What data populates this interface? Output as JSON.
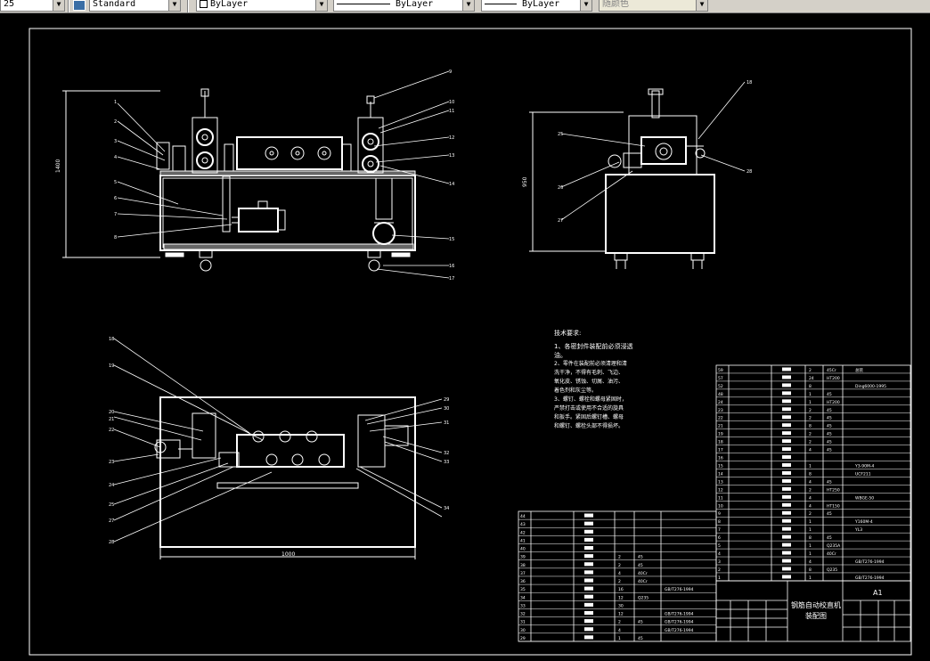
{
  "toolbar": {
    "text_height": "25",
    "dim_style": "Standard",
    "layer": "ByLayer",
    "linetype": "ByLayer",
    "lineweight": "ByLayer",
    "color": "随颜色"
  },
  "drawing": {
    "front_callouts": [
      "1",
      "2",
      "3",
      "4",
      "5",
      "6",
      "7",
      "8",
      "9",
      "10",
      "11",
      "12",
      "13",
      "14",
      "15",
      "16",
      "17"
    ],
    "side_callouts": [
      "18",
      "25",
      "26",
      "27",
      "28"
    ],
    "plan_callouts": [
      "18",
      "19",
      "20",
      "21",
      "22",
      "23",
      "24",
      "25",
      "27",
      "28",
      "29",
      "30",
      "31",
      "32",
      "33",
      "34"
    ],
    "front_dim": "1400",
    "side_dim": "950",
    "plan_dim": "1000",
    "notes_title": "技术要求:",
    "notes": [
      "1、各密封件装配前必须浸透",
      "油。",
      "2、零件在装配前必须清理和清",
      "洗干净，不得有毛刺、飞边、",
      "氧化皮、锈蚀、切屑、油污、",
      "着色剂和灰尘等。",
      "3、螺钉、螺栓和螺母紧固时，",
      "严禁打击或使用不合适的旋具",
      "和扳手。紧固后螺钉槽、螺母",
      "和螺钉、螺栓头部不得损坏。"
    ],
    "title_block": {
      "name_line1": "钢筋自动校直机",
      "name_line2": "装配图",
      "sheet_size": "A1"
    },
    "bom_right": [
      {
        "no": "59",
        "name": "",
        "qty": "2",
        "mat": "45Cr",
        "std": "总装"
      },
      {
        "no": "57",
        "name": "",
        "qty": "24",
        "mat": "HT200",
        "std": ""
      },
      {
        "no": "52",
        "name": "",
        "qty": "8",
        "mat": "",
        "std": "Ding6000-1995"
      },
      {
        "no": "48",
        "name": "",
        "qty": "1",
        "mat": "45",
        "std": ""
      },
      {
        "no": "24",
        "name": "",
        "qty": "1",
        "mat": "HT200",
        "std": ""
      },
      {
        "no": "23",
        "name": "",
        "qty": "2",
        "mat": "45",
        "std": ""
      },
      {
        "no": "22",
        "name": "",
        "qty": "2",
        "mat": "45",
        "std": ""
      },
      {
        "no": "21",
        "name": "",
        "qty": "8",
        "mat": "45",
        "std": ""
      },
      {
        "no": "19",
        "name": "",
        "qty": "2",
        "mat": "45",
        "std": ""
      },
      {
        "no": "18",
        "name": "",
        "qty": "2",
        "mat": "45",
        "std": ""
      },
      {
        "no": "17",
        "name": "",
        "qty": "4",
        "mat": "45",
        "std": ""
      },
      {
        "no": "16",
        "name": "",
        "qty": "",
        "mat": "",
        "std": ""
      },
      {
        "no": "15",
        "name": "",
        "qty": "1",
        "mat": "",
        "std": "Y3-90M-4"
      },
      {
        "no": "14",
        "name": "",
        "qty": "8",
        "mat": "",
        "std": "UCF211"
      },
      {
        "no": "13",
        "name": "",
        "qty": "4",
        "mat": "45",
        "std": ""
      },
      {
        "no": "12",
        "name": "",
        "qty": "2",
        "mat": "HT250",
        "std": ""
      },
      {
        "no": "11",
        "name": "",
        "qty": "4",
        "mat": "",
        "std": "WBGE-50"
      },
      {
        "no": "10",
        "name": "",
        "qty": "4",
        "mat": "HT150",
        "std": ""
      },
      {
        "no": "9",
        "name": "",
        "qty": "2",
        "mat": "45",
        "std": ""
      },
      {
        "no": "8",
        "name": "",
        "qty": "1",
        "mat": "",
        "std": "Y160M-4"
      },
      {
        "no": "7",
        "name": "",
        "qty": "1",
        "mat": "",
        "std": "YL3"
      },
      {
        "no": "6",
        "name": "",
        "qty": "8",
        "mat": "45",
        "std": ""
      },
      {
        "no": "5",
        "name": "",
        "qty": "1",
        "mat": "Q235A",
        "std": ""
      },
      {
        "no": "4",
        "name": "",
        "qty": "1",
        "mat": "40Cr",
        "std": ""
      },
      {
        "no": "3",
        "name": "",
        "qty": "4",
        "mat": "",
        "std": "GB/T276-1994"
      },
      {
        "no": "2",
        "name": "",
        "qty": "8",
        "mat": "Q235",
        "std": ""
      },
      {
        "no": "1",
        "name": "",
        "qty": "1",
        "mat": "",
        "std": "GB/T276-1994"
      }
    ],
    "bom_left": [
      {
        "no": "44",
        "name": "",
        "qty": "",
        "mat": "",
        "std": ""
      },
      {
        "no": "43",
        "name": "",
        "qty": "",
        "mat": "",
        "std": ""
      },
      {
        "no": "42",
        "name": "",
        "qty": "",
        "mat": "",
        "std": ""
      },
      {
        "no": "41",
        "name": "",
        "qty": "",
        "mat": "",
        "std": ""
      },
      {
        "no": "40",
        "name": "",
        "qty": "",
        "mat": "",
        "std": ""
      },
      {
        "no": "39",
        "name": "",
        "qty": "2",
        "mat": "45",
        "std": ""
      },
      {
        "no": "38",
        "name": "",
        "qty": "2",
        "mat": "45",
        "std": ""
      },
      {
        "no": "37",
        "name": "",
        "qty": "4",
        "mat": "40Cr",
        "std": ""
      },
      {
        "no": "36",
        "name": "",
        "qty": "2",
        "mat": "40Cr",
        "std": ""
      },
      {
        "no": "35",
        "name": "",
        "qty": "16",
        "mat": "",
        "std": "GB/T276-1994"
      },
      {
        "no": "34",
        "name": "",
        "qty": "12",
        "mat": "Q235",
        "std": ""
      },
      {
        "no": "33",
        "name": "",
        "qty": "30",
        "mat": "",
        "std": ""
      },
      {
        "no": "32",
        "name": "",
        "qty": "12",
        "mat": "",
        "std": "GB/T276-1994"
      },
      {
        "no": "31",
        "name": "",
        "qty": "2",
        "mat": "45",
        "std": "GB/T276-1994"
      },
      {
        "no": "30",
        "name": "",
        "qty": "4",
        "mat": "",
        "std": "GB/T276-1994"
      },
      {
        "no": "29",
        "name": "",
        "qty": "1",
        "mat": "45",
        "std": ""
      }
    ]
  }
}
